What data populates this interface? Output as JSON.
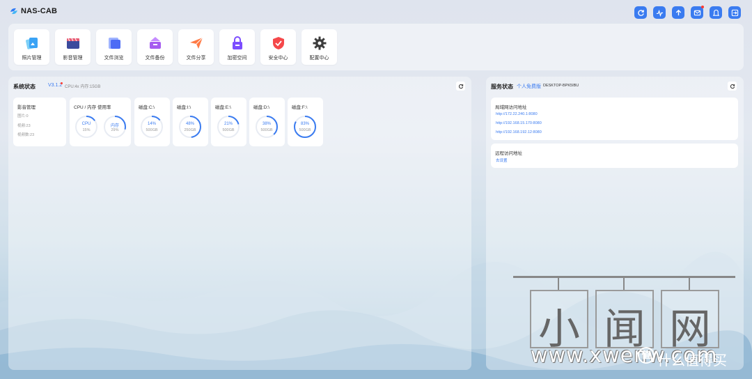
{
  "header": {
    "brand": "NAS-CAB",
    "buttons": [
      {
        "icon": "refresh-icon"
      },
      {
        "icon": "pulse-icon"
      },
      {
        "icon": "upload-icon"
      },
      {
        "icon": "mail-icon",
        "badge": true
      },
      {
        "icon": "user-icon"
      },
      {
        "icon": "logout-icon"
      }
    ]
  },
  "apps": [
    {
      "label": "照片管理",
      "icon": "photo-icon",
      "color": "#3aa3f5"
    },
    {
      "label": "影音管理",
      "icon": "video-icon",
      "color": "#3b4a9c"
    },
    {
      "label": "文件浏览",
      "icon": "folder-icon",
      "color": "#4d6cf5"
    },
    {
      "label": "文件备份",
      "icon": "backup-icon",
      "color": "#a65cf0"
    },
    {
      "label": "文件分享",
      "icon": "share-icon",
      "color": "#ff7a45"
    },
    {
      "label": "加密空间",
      "icon": "lock-icon",
      "color": "#7c4dff"
    },
    {
      "label": "安全中心",
      "icon": "shield-icon",
      "color": "#f5484a"
    },
    {
      "label": "配置中心",
      "icon": "gear-icon",
      "color": "#3c3c3c"
    }
  ],
  "system": {
    "title": "系统状态",
    "version": "V3.1.2",
    "info": "CPU:4x 内存:15GB",
    "media_card": {
      "title": "影音管理",
      "stats": [
        "图片:0",
        "视频:23",
        "视频数:23"
      ]
    },
    "cpu_card": {
      "title": "CPU / 内存 使用率",
      "rings": [
        {
          "top": "CPU",
          "sub": "15%",
          "value": 15
        },
        {
          "top": "内存",
          "sub": "29%",
          "value": 29
        }
      ]
    },
    "disks": [
      {
        "title": "磁盘:C:\\",
        "pct": "14%",
        "size": "500GB",
        "value": 14
      },
      {
        "title": "磁盘:I:\\",
        "pct": "48%",
        "size": "250GB",
        "value": 48
      },
      {
        "title": "磁盘:E:\\",
        "pct": "21%",
        "size": "500GB",
        "value": 21
      },
      {
        "title": "磁盘:D:\\",
        "pct": "38%",
        "size": "500GB",
        "value": 38
      },
      {
        "title": "磁盘:F:\\",
        "pct": "83%",
        "size": "500GB",
        "value": 83
      }
    ]
  },
  "service": {
    "title": "服务状态",
    "edition": "个人免费版",
    "host": "DESKTOP-BPK5IBU",
    "lan": {
      "title": "局域网访问地址",
      "links": [
        "http://172.22.240.1:8080",
        "http://192.168.15.170:8080",
        "http://192.168.192.12:8080"
      ]
    },
    "remote": {
      "title": "远程访问地址",
      "link": "去设置"
    }
  },
  "watermark": {
    "chars": [
      "小",
      "闻",
      "网"
    ],
    "url": "www.xwenw.com",
    "badge": "值",
    "site": "什么值得买"
  },
  "colors": {
    "accent": "#3a7bf0",
    "ring_track": "#e8ecf3"
  }
}
